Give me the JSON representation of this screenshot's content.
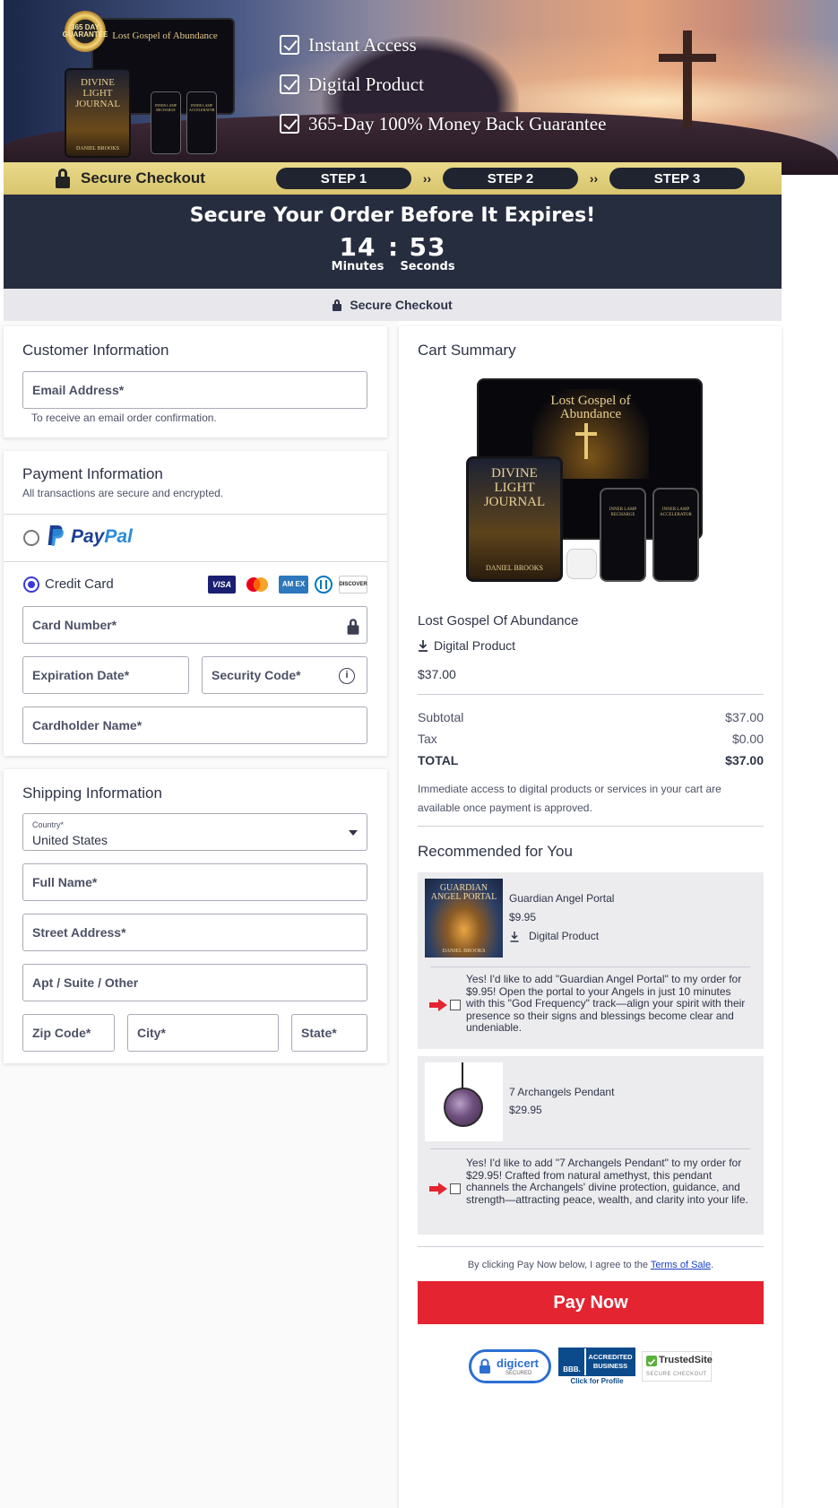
{
  "hero": {
    "seal_text": "365 DAY GUARANTEE",
    "monitor_title": "Lost Gospel of Abundance",
    "book_title": "DIVINE LIGHT JOURNAL",
    "book_author": "DANIEL BROOKS",
    "phone1_title": "INNER LAMP RECHARGE",
    "phone2_title": "INNER LAMP ACCELERATOR",
    "bullets": [
      "Instant Access",
      "Digital Product",
      "365-Day 100% Money Back Guarantee"
    ]
  },
  "stepbar": {
    "secure_label": "Secure Checkout",
    "steps": [
      "STEP 1",
      "STEP 2",
      "STEP 3"
    ],
    "arrow": "››"
  },
  "timer": {
    "title": "Secure Your Order Before It Expires!",
    "minutes": "14",
    "separator": ":",
    "seconds": "53",
    "minutes_label": "Minutes",
    "seconds_label": "Seconds"
  },
  "secure_strip": {
    "label": "Secure Checkout"
  },
  "customer": {
    "title": "Customer Information",
    "email_label": "Email Address*",
    "email_hint": "To receive an email order confirmation."
  },
  "payment": {
    "title": "Payment Information",
    "subtitle": "All transactions are secure and encrypted.",
    "paypal_label_1": "Pay",
    "paypal_label_2": "Pal",
    "credit_card_label": "Credit Card",
    "card_logos": [
      "VISA",
      "AM EX",
      "DISCOVER"
    ],
    "card_number_label": "Card Number*",
    "expiration_label": "Expiration Date*",
    "security_code_label": "Security Code*",
    "info_glyph": "i",
    "cardholder_label": "Cardholder Name*"
  },
  "shipping": {
    "title": "Shipping Information",
    "country_label": "Country*",
    "country_value": "United States",
    "full_name_label": "Full Name*",
    "street_label": "Street Address*",
    "apt_label": "Apt / Suite / Other",
    "zip_label": "Zip Code*",
    "city_label": "City*",
    "state_label": "State*"
  },
  "cart": {
    "title": "Cart Summary",
    "product_name": "Lost Gospel Of Abundance",
    "product_type": "Digital Product",
    "product_price": "$37.00",
    "subtotal_label": "Subtotal",
    "subtotal_value": "$37.00",
    "tax_label": "Tax",
    "tax_value": "$0.00",
    "total_label": "TOTAL",
    "total_value": "$37.00",
    "note_line1": "Immediate access to digital products or services in your cart are",
    "note_line2": "available once payment is approved."
  },
  "recommended": {
    "title": "Recommended for You",
    "items": [
      {
        "name": "Guardian Angel Portal",
        "price": "$9.95",
        "type": "Digital Product",
        "cover_title": "GUARDIAN ANGEL PORTAL",
        "cover_author": "DANIEL BROOKS",
        "offer": "Yes! I'd like to add \"Guardian Angel Portal\" to my order for $9.95! Open the portal to your Angels in just 10 minutes with this \"God Frequency\" track—align your spirit with their presence so their signs and blessings become clear and undeniable."
      },
      {
        "name": "7 Archangels Pendant",
        "price": "$29.95",
        "offer": "Yes! I'd like to add \"7 Archangels Pendant\" to my order for $29.95! Crafted from natural amethyst, this pendant channels the Archangels' divine protection, guidance, and strength—attracting peace, wealth, and clarity into your life."
      }
    ]
  },
  "checkout": {
    "terms_prefix": "By clicking Pay Now below, I agree to the ",
    "terms_link": "Terms of Sale",
    "terms_suffix": ".",
    "pay_button": "Pay Now"
  },
  "badges": {
    "digicert_name": "digicert",
    "digicert_sub": "SECURED",
    "bbb_line1": "ACCREDITED",
    "bbb_line2": "BUSINESS",
    "bbb_logo": "BBB.",
    "bbb_cta": "Click for Profile",
    "trustedsite_name": "TrustedSite",
    "trustedsite_sub": "SECURE CHECKOUT"
  },
  "colors": {
    "accent_red": "#e42431",
    "radio_blue": "#3a3ad6",
    "timer_bg": "#262d3f",
    "step_bar_gold": "#dfcd7a"
  }
}
